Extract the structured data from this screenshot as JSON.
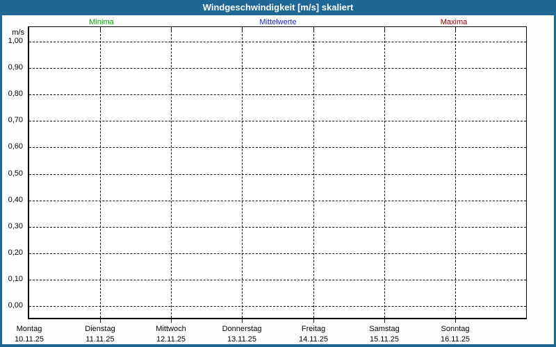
{
  "window": {
    "title": "Windgeschwindigkeit [m/s] skaliert"
  },
  "colors": {
    "frame": "#1F6795",
    "titlebar_bg": "#1F6795",
    "titlebar_text": "#FFFFFF",
    "axis_and_grid": "#000000",
    "minima_green": "#00A800",
    "mittelwerte_blue": "#2222CC",
    "maxima_red": "#A40000"
  },
  "legend": {
    "items": [
      {
        "label": "Minima",
        "color": "#00A800"
      },
      {
        "label": "Mittelwerte",
        "color": "#2222CC"
      },
      {
        "label": "Maxima",
        "color": "#A40000"
      }
    ]
  },
  "chart_data": {
    "type": "line",
    "title": "Windgeschwindigkeit [m/s] skaliert",
    "ylabel": "m/s",
    "ylim": [
      0.0,
      1.0
    ],
    "y_tick_step": 0.1,
    "y_ticks": [
      "1,00",
      "0,90",
      "0,80",
      "0,70",
      "0,60",
      "0,50",
      "0,40",
      "0,30",
      "0,20",
      "0,10",
      "0,00"
    ],
    "x_categories": [
      {
        "day": "Montag",
        "date": "10.11.25"
      },
      {
        "day": "Dienstag",
        "date": "11.11.25"
      },
      {
        "day": "Mittwoch",
        "date": "12.11.25"
      },
      {
        "day": "Donnerstag",
        "date": "13.11.25"
      },
      {
        "day": "Freitag",
        "date": "14.11.25"
      },
      {
        "day": "Samstag",
        "date": "15.11.25"
      },
      {
        "day": "Sonntag",
        "date": "16.11.25"
      }
    ],
    "series": [
      {
        "name": "Minima",
        "color": "#00A800",
        "values": []
      },
      {
        "name": "Mittelwerte",
        "color": "#2222CC",
        "values": []
      },
      {
        "name": "Maxima",
        "color": "#A40000",
        "values": []
      }
    ],
    "grid": "dashed",
    "legend_position": "top"
  }
}
